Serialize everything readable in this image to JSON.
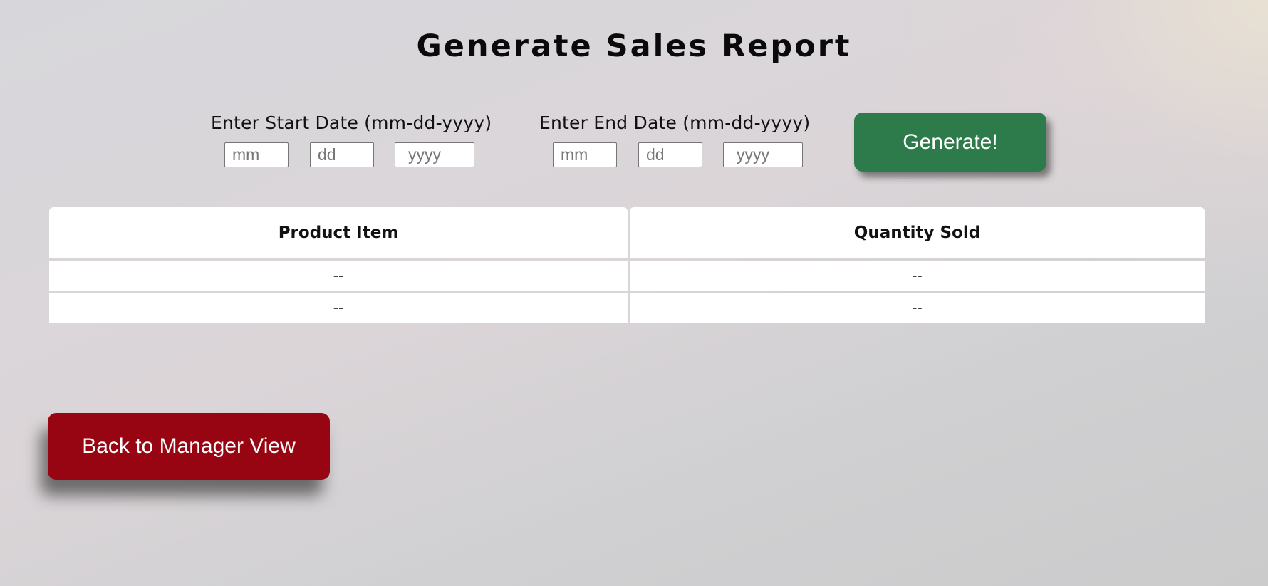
{
  "page": {
    "title": "Generate Sales Report"
  },
  "start_date": {
    "label": "Enter Start Date (mm-dd-yyyy)",
    "mm_placeholder": "mm",
    "dd_placeholder": "dd",
    "yyyy_placeholder": "yyyy",
    "mm_value": "",
    "dd_value": "",
    "yyyy_value": ""
  },
  "end_date": {
    "label": "Enter End Date (mm-dd-yyyy)",
    "mm_placeholder": "mm",
    "dd_placeholder": "dd",
    "yyyy_placeholder": "yyyy",
    "mm_value": "",
    "dd_value": "",
    "yyyy_value": ""
  },
  "generate_button": {
    "label": "Generate!",
    "color": "#2d7b4a"
  },
  "table": {
    "headers": [
      "Product Item",
      "Quantity Sold"
    ],
    "rows": [
      [
        "--",
        "--"
      ],
      [
        "--",
        "--"
      ]
    ]
  },
  "back_button": {
    "label": "Back to Manager View",
    "color": "#970512"
  }
}
